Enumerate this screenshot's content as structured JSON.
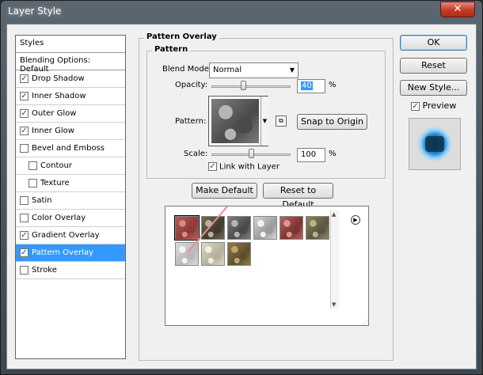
{
  "window": {
    "title": "Layer Style",
    "close_glyph": "✕"
  },
  "styles_list": {
    "header": "Styles",
    "blending_default": "Blending Options: Default",
    "items": [
      {
        "label": "Drop Shadow",
        "checked": true,
        "indent": false,
        "active": false
      },
      {
        "label": "Inner Shadow",
        "checked": true,
        "indent": false,
        "active": false
      },
      {
        "label": "Outer Glow",
        "checked": true,
        "indent": false,
        "active": false
      },
      {
        "label": "Inner Glow",
        "checked": true,
        "indent": false,
        "active": false
      },
      {
        "label": "Bevel and Emboss",
        "checked": false,
        "indent": false,
        "active": false
      },
      {
        "label": "Contour",
        "checked": false,
        "indent": true,
        "active": false
      },
      {
        "label": "Texture",
        "checked": false,
        "indent": true,
        "active": false
      },
      {
        "label": "Satin",
        "checked": false,
        "indent": false,
        "active": false
      },
      {
        "label": "Color Overlay",
        "checked": false,
        "indent": false,
        "active": false
      },
      {
        "label": "Gradient Overlay",
        "checked": true,
        "indent": false,
        "active": false
      },
      {
        "label": "Pattern Overlay",
        "checked": true,
        "indent": false,
        "active": true
      },
      {
        "label": "Stroke",
        "checked": false,
        "indent": false,
        "active": false
      }
    ]
  },
  "actions": {
    "ok": "OK",
    "reset": "Reset",
    "new_style": "New Style...",
    "preview_label": "Preview",
    "preview_checked": true
  },
  "pattern_overlay": {
    "section_title": "Pattern Overlay",
    "group_title": "Pattern",
    "blend_mode_label": "Blend Mode:",
    "blend_mode_value": "Normal",
    "opacity_label": "Opacity:",
    "opacity_value": "40",
    "opacity_unit": "%",
    "pattern_label": "Pattern:",
    "snap_to_origin": "Snap to Origin",
    "scale_label": "Scale:",
    "scale_value": "100",
    "scale_unit": "%",
    "link_with_layer": "Link with Layer",
    "link_checked": true,
    "make_default": "Make Default",
    "reset_to_default": "Reset to Default"
  },
  "icons": {
    "checkmark": "✓",
    "dropdown": "▼",
    "scroll_up": "▲",
    "scroll_down": "▼",
    "menu_arrow": "▶",
    "snap_icon": "⧉",
    "resize_grip": "⋰"
  },
  "pattern_swatches": [
    {
      "name": "red-granite",
      "colors": [
        "#b85a58",
        "#d88a86",
        "#8e3a38"
      ]
    },
    {
      "name": "dark-pebbles",
      "colors": [
        "#6f6b55",
        "#b8b49c",
        "#3e3b2f"
      ]
    },
    {
      "name": "grey-gravel",
      "colors": [
        "#7d7d7d",
        "#b5b5b5",
        "#4a4a4a"
      ]
    },
    {
      "name": "light-speckle",
      "colors": [
        "#d5d5d5",
        "#f2f2f2",
        "#9b9b9b"
      ]
    },
    {
      "name": "red-rock",
      "colors": [
        "#b8615c",
        "#dd958f",
        "#7a3431"
      ]
    },
    {
      "name": "olive-stone",
      "colors": [
        "#8c8462",
        "#b8b18d",
        "#5b5540"
      ]
    },
    {
      "name": "pale-marble",
      "colors": [
        "#dcdcdc",
        "#f4f4f4",
        "#b9b9b9"
      ]
    },
    {
      "name": "cream-marble",
      "colors": [
        "#dcd9cc",
        "#f2efe3",
        "#b4b09c"
      ]
    },
    {
      "name": "brown-sand",
      "colors": [
        "#8f7a48",
        "#bca571",
        "#5e4f2e"
      ]
    }
  ],
  "colors": {
    "active_row": "#3399ff",
    "selection_line": "#f08a8a"
  }
}
